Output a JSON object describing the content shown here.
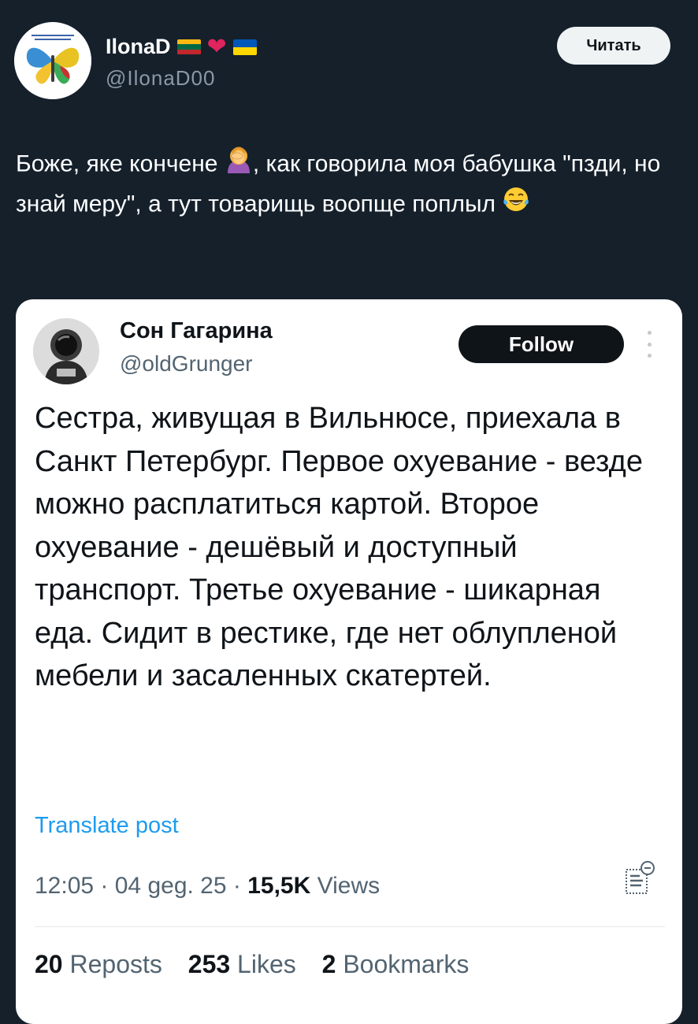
{
  "post": {
    "author": {
      "name": "IlonaD",
      "flags": [
        "flag-lithuania",
        "heart-red",
        "flag-ukraine"
      ],
      "handle": "@IlonaD00"
    },
    "read_button": "Читать",
    "text_parts": [
      "Боже, яке кончене ",
      ", как говорила моя бабушка \"пзди, но знай меру\", а тут товарищь воопще поплыл "
    ],
    "emojis": [
      "facepalm-woman-emoji",
      "tears-of-joy-emoji"
    ]
  },
  "quoted": {
    "author": {
      "name": "Сон Гагарина",
      "handle": "@oldGrunger"
    },
    "follow_button": "Follow",
    "text": "Сестра, живущая в Вильнюсе, приехала в Санкт Петербург. Первое охуевание - везде можно расплатиться картой. Второе охуевание - дешёвый и доступный транспорт. Третье охуевание - шикарная еда. Сидит в рестике, где нет облупленой мебели и засаленных скатертей.",
    "translate_link": "Translate post",
    "meta": {
      "time": "12:05",
      "date": "04 geg. 25",
      "views_count": "15,5K",
      "views_label": "Views"
    },
    "stats": {
      "reposts_count": "20",
      "reposts_label": "Reposts",
      "likes_count": "253",
      "likes_label": "Likes",
      "bookmarks_count": "2",
      "bookmarks_label": "Bookmarks"
    }
  },
  "colors": {
    "background": "#15202b",
    "card": "#ffffff",
    "link": "#1d9bf0",
    "muted_dark": "#8b98a5",
    "muted_light": "#536471",
    "heart": "#e0245e"
  }
}
